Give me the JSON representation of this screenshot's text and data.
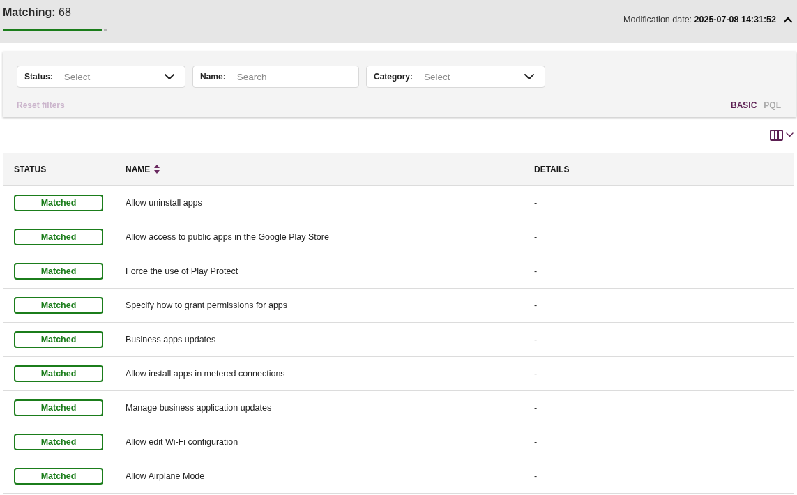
{
  "header": {
    "title": "**Matching:** 68",
    "progress": {
      "level": 0.95
    },
    "modification": "Modification date: **2025-07-08 14:31:52**",
    "expanded": true
  },
  "filters": {
    "fields": [
      {
        "kind": "select",
        "label": "Status:",
        "placeholder": "Select"
      },
      {
        "kind": "text",
        "label": "Name:",
        "placeholder": "Search"
      },
      {
        "kind": "select",
        "label": "Category:",
        "placeholder": "Select"
      }
    ],
    "reset": {
      "label": "Reset filters",
      "disabled": true
    },
    "modes": [
      {
        "label": "BASIC",
        "selected": true
      },
      {
        "label": "PQL",
        "selected": false
      }
    ]
  },
  "table": {
    "columns": [
      {
        "label": "STATUS",
        "sortable": false
      },
      {
        "label": "NAME",
        "sortable": true
      },
      {
        "label": "DETAILS",
        "sortable": false
      }
    ],
    "rows": [
      {
        "status": "Matched",
        "name": "Allow uninstall apps",
        "details": "-"
      },
      {
        "status": "Matched",
        "name": "Allow access to public apps in the Google Play Store",
        "details": "-"
      },
      {
        "status": "Matched",
        "name": "Force the use of Play Protect",
        "details": "-"
      },
      {
        "status": "Matched",
        "name": "Specify how to grant permissions for apps",
        "details": "-"
      },
      {
        "status": "Matched",
        "name": "Business apps updates",
        "details": "-"
      },
      {
        "status": "Matched",
        "name": "Allow install apps in metered connections",
        "details": "-"
      },
      {
        "status": "Matched",
        "name": "Manage business application updates",
        "details": "-"
      },
      {
        "status": "Matched",
        "name": "Allow edit Wi-Fi configuration",
        "details": "-"
      },
      {
        "status": "Matched",
        "name": "Allow Airplane Mode",
        "details": "-"
      }
    ]
  }
}
